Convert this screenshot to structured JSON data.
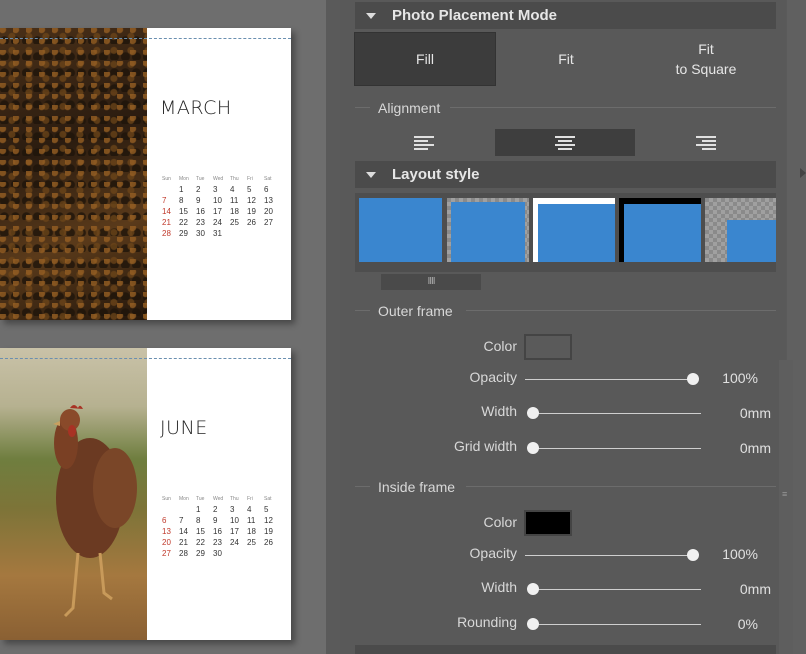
{
  "calendar": {
    "weekdays": [
      "Sun",
      "Mon",
      "Tue",
      "Wed",
      "Thu",
      "Fri",
      "Sat"
    ],
    "march": {
      "name": "MARCH",
      "days": [
        "",
        "1",
        "2",
        "3",
        "4",
        "5",
        "6",
        "7",
        "8",
        "9",
        "10",
        "11",
        "12",
        "13",
        "14",
        "15",
        "16",
        "17",
        "18",
        "19",
        "20",
        "21",
        "22",
        "23",
        "24",
        "25",
        "26",
        "27",
        "28",
        "29",
        "30",
        "31",
        "",
        "",
        ""
      ],
      "red_days": [
        "7",
        "14",
        "21",
        "28"
      ]
    },
    "june": {
      "name": "JUNE",
      "days": [
        "",
        "",
        "1",
        "2",
        "3",
        "4",
        "5",
        "6",
        "7",
        "8",
        "9",
        "10",
        "11",
        "12",
        "13",
        "14",
        "15",
        "16",
        "17",
        "18",
        "19",
        "20",
        "21",
        "22",
        "23",
        "24",
        "25",
        "26",
        "27",
        "28",
        "29",
        "30",
        "",
        "",
        ""
      ],
      "red_days": [
        "6",
        "13",
        "20",
        "27"
      ]
    }
  },
  "panel": {
    "photo_placement": {
      "title": "Photo Placement Mode",
      "options": [
        "Fill",
        "Fit",
        "Fit\nto Square"
      ],
      "selected": "Fill"
    },
    "alignment": {
      "label": "Alignment",
      "options": [
        "left",
        "center",
        "right"
      ],
      "selected": "center"
    },
    "layout_style": {
      "title": "Layout style",
      "scroll_handle": "IIII"
    },
    "outer_frame": {
      "label": "Outer frame",
      "color_label": "Color",
      "color": "#5a5a5a",
      "opacity_label": "Opacity",
      "opacity": "100%",
      "opacity_value": 100,
      "width_label": "Width",
      "width": "0mm",
      "grid_width_label": "Grid width",
      "grid_width": "0mm"
    },
    "inside_frame": {
      "label": "Inside frame",
      "color_label": "Color",
      "color": "#000000",
      "opacity_label": "Opacity",
      "opacity": "100%",
      "opacity_value": 100,
      "width_label": "Width",
      "width": "0mm",
      "rounding_label": "Rounding",
      "rounding": "0%"
    }
  },
  "colors": {
    "accent_blue": "#3a86cf",
    "panel_bg": "#595959",
    "section_bg": "#4b4b4b"
  }
}
